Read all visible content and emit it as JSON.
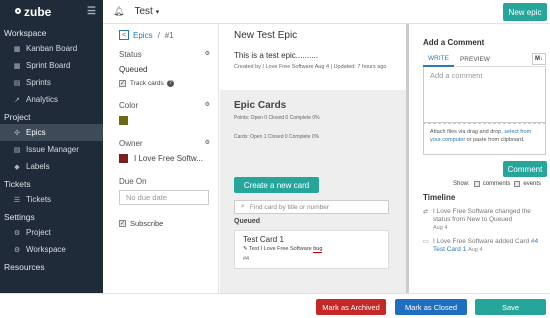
{
  "sidebar": {
    "logo": "zube",
    "sections": [
      {
        "title": "Workspace",
        "items": [
          "Kanban Board",
          "Sprint Board",
          "Sprints",
          "Analytics"
        ]
      },
      {
        "title": "Project",
        "items": [
          "Epics",
          "Issue Manager",
          "Labels"
        ]
      },
      {
        "title": "Tickets",
        "items": [
          "Tickets"
        ]
      },
      {
        "title": "Settings",
        "items": [
          "Project",
          "Workspace"
        ]
      },
      {
        "title": "Resources",
        "items": []
      }
    ],
    "active_item": "Epics"
  },
  "topbar": {
    "project": "Test",
    "new_epic": "New epic"
  },
  "details": {
    "breadcrumb_link": "Epics",
    "breadcrumb_sep": "/",
    "breadcrumb_id": "#1",
    "status_label": "Status",
    "status_value": "Queued",
    "track_cards": "Track cards",
    "color_label": "Color",
    "color_value": "#6b6b12",
    "owner_label": "Owner",
    "owner_name": "I Love Free Softw...",
    "due_label": "Due On",
    "due_placeholder": "No due date",
    "subscribe": "Subscribe"
  },
  "epic": {
    "title": "New Test Epic",
    "description": "This is a test epic..........",
    "meta": "Created by I Love Free Software Aug 4 | Updated: 7 hours ago",
    "cards_heading": "Epic Cards",
    "points": "Points: Open 0 Closed 0 Complete 0%",
    "cards_summary": "Cards: Open 1 Closed 0 Complete 0%",
    "create_card": "Create a new card",
    "find_placeholder": "Find card by title or number",
    "queued_heading": "Queued",
    "card": {
      "title": "Test Card 1",
      "subtitle_prefix": "Test I Love Free Software",
      "subtitle_tag": "bug",
      "number": "#4"
    }
  },
  "comments": {
    "heading": "Add a Comment",
    "tab_write": "WRITE",
    "tab_preview": "PREVIEW",
    "markdown_badge": "M↓",
    "placeholder": "Add a comment",
    "attach_pre": "Attach files via drag and drop, ",
    "attach_link": "select from your computer",
    "attach_post": " or paste from clipboard.",
    "comment_button": "Comment",
    "show_label": "Show:",
    "show_comments": "comments",
    "show_events": "events",
    "timeline_heading": "Timeline",
    "events": [
      {
        "text": "I Love Free Software changed the status from New to Queued",
        "link": "",
        "date": "Aug 4"
      },
      {
        "text": "I Love Free Software added Card ",
        "link": "#4 Test Card 1",
        "date": "Aug 4"
      }
    ]
  },
  "footer": {
    "archive": "Mark as Archived",
    "closed": "Mark as Closed",
    "save": "Save"
  }
}
